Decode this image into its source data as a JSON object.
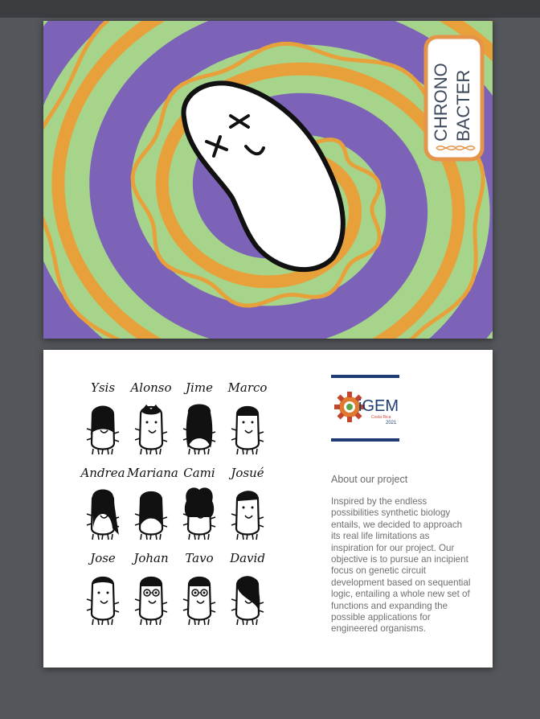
{
  "cover": {
    "title_line1": "CHRONO",
    "title_line2": "BACTER",
    "colors": {
      "green": "#a6d48a",
      "purple": "#7c63b8",
      "orange": "#e8a13a",
      "badge_border": "#e6944a",
      "title_text": "#3d4a5c"
    },
    "illustration": "dizzy-bacterium-icon"
  },
  "team": {
    "members": [
      {
        "name": "Ysis"
      },
      {
        "name": "Alonso"
      },
      {
        "name": "Jime"
      },
      {
        "name": "Marco"
      },
      {
        "name": "Andrea"
      },
      {
        "name": "Mariana"
      },
      {
        "name": "Cami"
      },
      {
        "name": "Josué"
      },
      {
        "name": "Jose"
      },
      {
        "name": "Johan"
      },
      {
        "name": "Tavo"
      },
      {
        "name": "David"
      }
    ]
  },
  "logo": {
    "text": "iGEM",
    "subtitle": "Costa Rica",
    "year": "2021",
    "icon": "gear-logo-icon"
  },
  "about": {
    "title": "About our project",
    "body": "Inspired by the endless possibilities synthetic biology entails, we decided to approach its real life limitations as inspiration for our project. Our objective is to pursue an incipient focus on genetic circuit development based on sequential logic, entailing a whole new set of functions and expanding the possible applications for engineered organisms."
  }
}
